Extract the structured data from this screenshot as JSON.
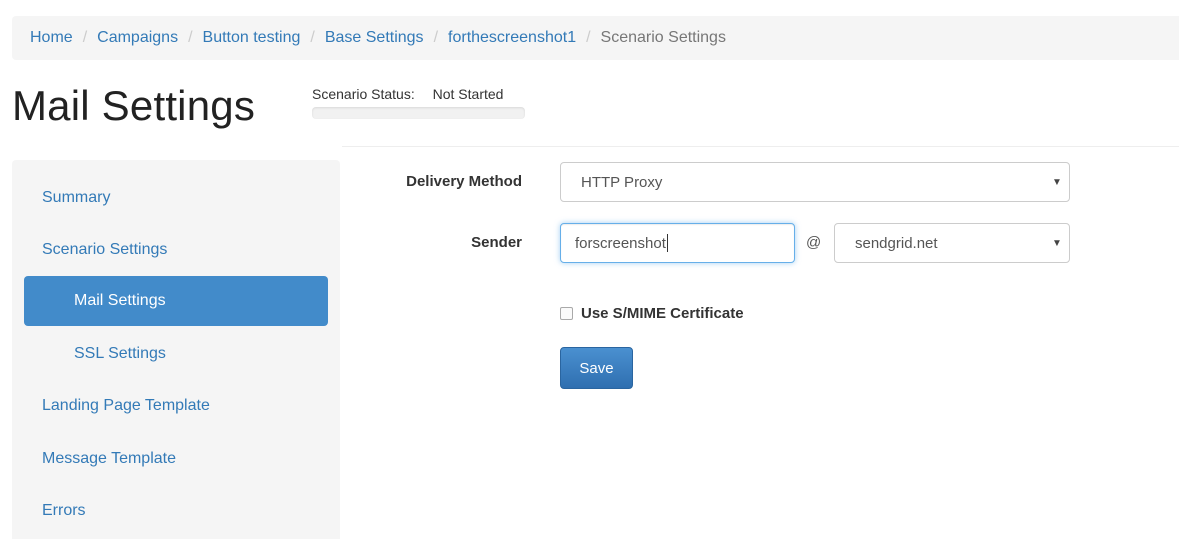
{
  "breadcrumb": {
    "items": [
      "Home",
      "Campaigns",
      "Button testing",
      "Base Settings",
      "forthescreenshot1"
    ],
    "active": "Scenario Settings",
    "separator": "/"
  },
  "page": {
    "title": "Mail Settings"
  },
  "status": {
    "label": "Scenario Status:",
    "value": "Not Started",
    "progress_percent": 0
  },
  "sidebar": {
    "items": [
      {
        "label": "Summary",
        "active": false,
        "level": 1
      },
      {
        "label": "Scenario Settings",
        "active": false,
        "level": 1
      },
      {
        "label": "Mail Settings",
        "active": true,
        "level": 2
      },
      {
        "label": "SSL Settings",
        "active": false,
        "level": 2
      },
      {
        "label": "Landing Page Template",
        "active": false,
        "level": 1
      },
      {
        "label": "Message Template",
        "active": false,
        "level": 1
      },
      {
        "label": "Errors",
        "active": false,
        "level": 1
      }
    ]
  },
  "form": {
    "delivery_method": {
      "label": "Delivery Method",
      "value": "HTTP Proxy"
    },
    "sender": {
      "label": "Sender",
      "local_part": "forscreenshot",
      "at": "@",
      "domain": "sendgrid.net"
    },
    "smime": {
      "label": "Use S/MIME Certificate",
      "checked": false
    },
    "save_label": "Save"
  },
  "icons": {
    "select_caret": "caret-down-icon"
  },
  "colors": {
    "link": "#337ab7",
    "active_nav": "#428bca",
    "sidebar_bg": "#f5f5f5",
    "button": "#337ab7"
  }
}
